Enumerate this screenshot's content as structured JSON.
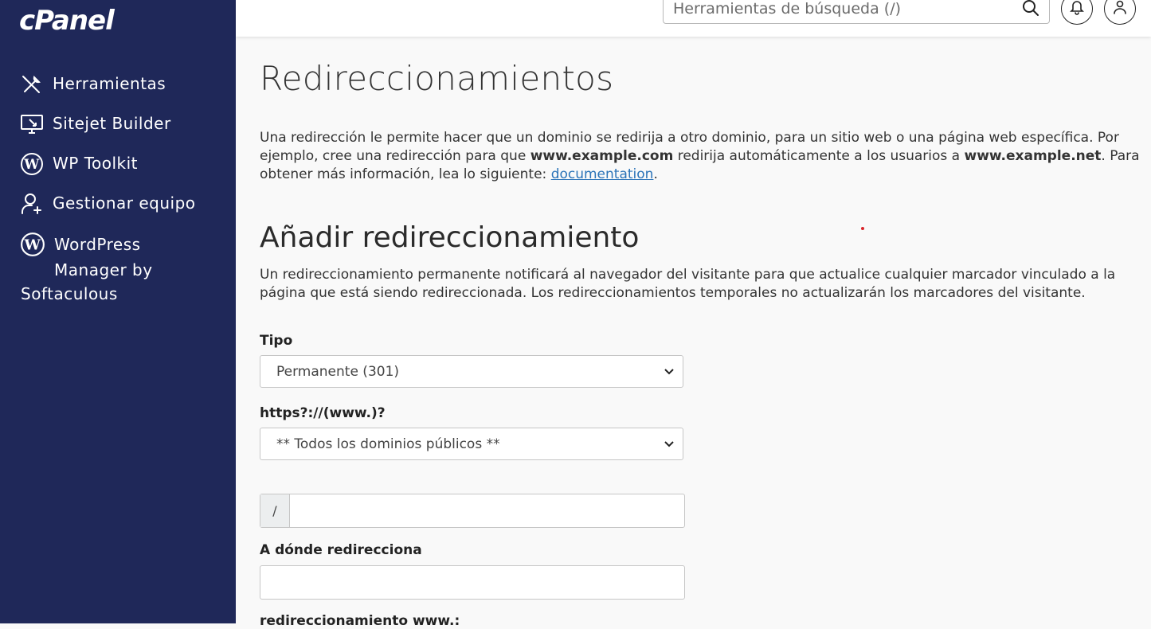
{
  "brand": {
    "logo_text": "cPanel"
  },
  "sidebar": {
    "items": [
      {
        "label": "Herramientas",
        "icon": "tools-icon"
      },
      {
        "label": "Sitejet Builder",
        "icon": "monitor-icon"
      },
      {
        "label": "WP Toolkit",
        "icon": "wordpress-icon"
      },
      {
        "label": "Gestionar equipo",
        "icon": "user-add-icon"
      }
    ],
    "wordpress_manager": {
      "line1": "WordPress",
      "line2": "Manager by",
      "line3": "Softaculous",
      "icon": "wordpress-icon"
    }
  },
  "topbar": {
    "search_placeholder": "Herramientas de búsqueda (/)",
    "icons": [
      "search-icon",
      "bell-icon",
      "user-icon"
    ]
  },
  "main": {
    "title": "Redireccionamientos",
    "intro": {
      "p1": "Una redirección le permite hacer que un dominio se redirija a otro dominio, para un sitio web o una página web específica. Por ejemplo, cree una redirección para que ",
      "bold1": "www.example.com",
      "p2": " redirija automáticamente a los usuarios a ",
      "bold2": "www.example.net",
      "p3": ". Para obtener más información, lea lo siguiente: ",
      "link": "documentation",
      "p4": "."
    },
    "section_title": "Añadir redireccionamiento",
    "section_desc": "Un redireccionamiento permanente notificará al navegador del visitante para que actualice cualquier marcador vinculado a la página que está siendo redireccionada. Los redireccionamientos temporales no actualizarán los marcadores del visitante.",
    "form": {
      "type_label": "Tipo",
      "type_value": "Permanente (301)",
      "domain_label": "https?://(www.)?",
      "domain_value": "** Todos los dominios públicos **",
      "path_prefix": "/",
      "path_value": "",
      "target_label": "A dónde redirecciona",
      "target_value": "",
      "next_label": "redireccionamiento www.:"
    }
  },
  "colors": {
    "sidebar_bg": "#1f2859",
    "link": "#2a73b8",
    "accent_dot": "#d9262b"
  }
}
